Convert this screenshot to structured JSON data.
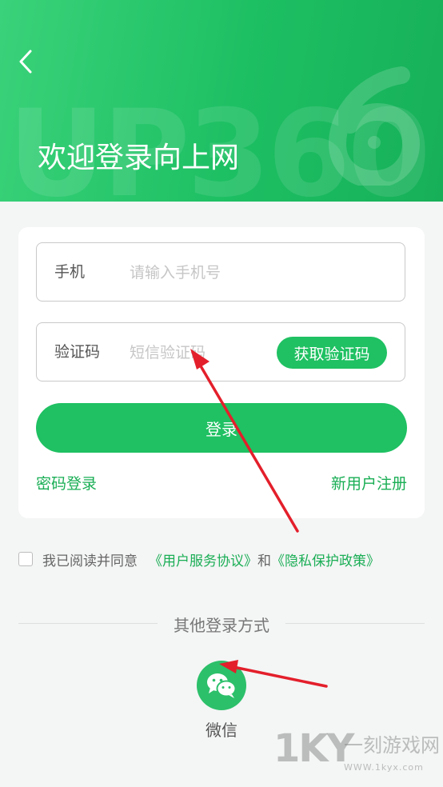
{
  "header": {
    "title": "欢迎登录向上网",
    "watermark_text": "UP360",
    "bg_gradient_start": "#3ad27a",
    "bg_gradient_end": "#17b059",
    "back_icon": "chevron-left-icon"
  },
  "form": {
    "phone": {
      "label": "手机",
      "placeholder": "请输入手机号",
      "value": ""
    },
    "code": {
      "label": "验证码",
      "placeholder": "短信验证码",
      "value": "",
      "get_code_label": "获取验证码"
    },
    "login_label": "登录",
    "password_login_label": "密码登录",
    "register_label": "新用户注册",
    "accent_color": "#1fc162"
  },
  "agreement": {
    "prefix": "我已阅读并同意",
    "terms_link": "《用户服务协议》",
    "conjunction": "和",
    "privacy_link": "《隐私保护政策》",
    "checked": false
  },
  "other_login": {
    "title": "其他登录方式",
    "wechat_label": "微信",
    "wechat_icon": "wechat-icon"
  },
  "watermark": {
    "brand": "1KY",
    "name": "一刻游戏网",
    "url": "WWW.1kyx.com"
  }
}
